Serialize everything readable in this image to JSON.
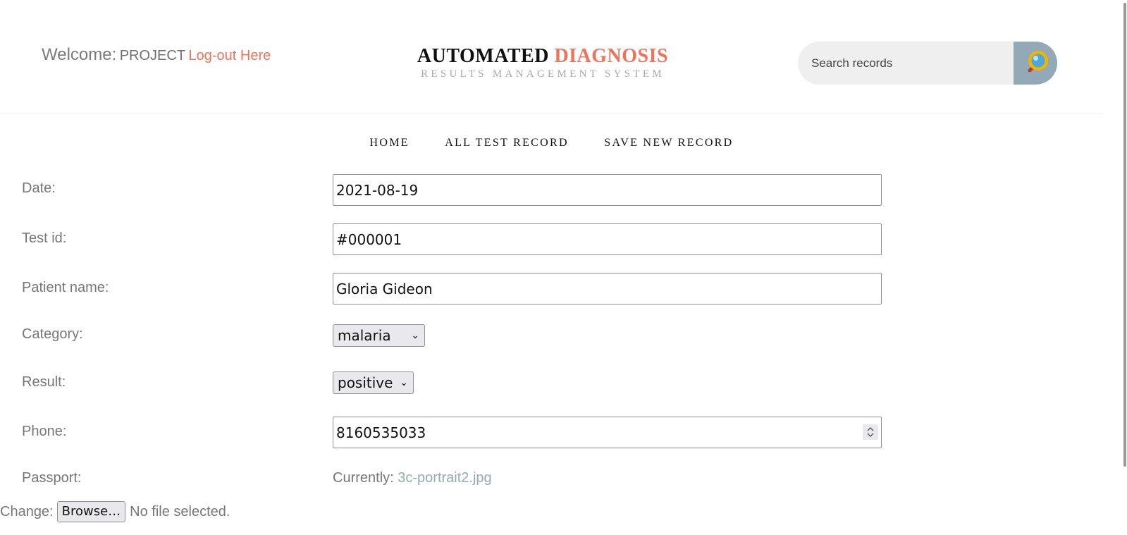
{
  "header": {
    "welcome_label": "Welcome:",
    "username": "PROJECT",
    "logout_label": "Log-out Here",
    "brand_title_main": "AUTOMATED",
    "brand_title_accent": "DIAGNOSIS",
    "brand_subtitle": "RESULTS MANAGEMENT SYSTEM",
    "search_placeholder": "Search records",
    "search_icon": "magnifier-icon"
  },
  "nav": {
    "items": [
      {
        "label": "HOME"
      },
      {
        "label": "ALL TEST RECORD"
      },
      {
        "label": "SAVE NEW RECORD"
      }
    ]
  },
  "form": {
    "date": {
      "label": "Date:",
      "value": "2021-08-19"
    },
    "test_id": {
      "label": "Test id:",
      "value": "#000001"
    },
    "patient_name": {
      "label": "Patient name:",
      "value": "Gloria Gideon"
    },
    "category": {
      "label": "Category:",
      "value": "malaria"
    },
    "result": {
      "label": "Result:",
      "value": "positive"
    },
    "phone": {
      "label": "Phone:",
      "value": "8160535033"
    },
    "passport": {
      "label": "Passport:",
      "currently_label": "Currently:",
      "current_file": "3c-portrait2.jpg",
      "change_label": "Change:",
      "browse_label": "Browse…",
      "no_file_text": "No file selected."
    }
  },
  "colors": {
    "accent": "#f07258",
    "search_button": "#94a9b7",
    "link_blue_grey": "#94a9b7"
  }
}
